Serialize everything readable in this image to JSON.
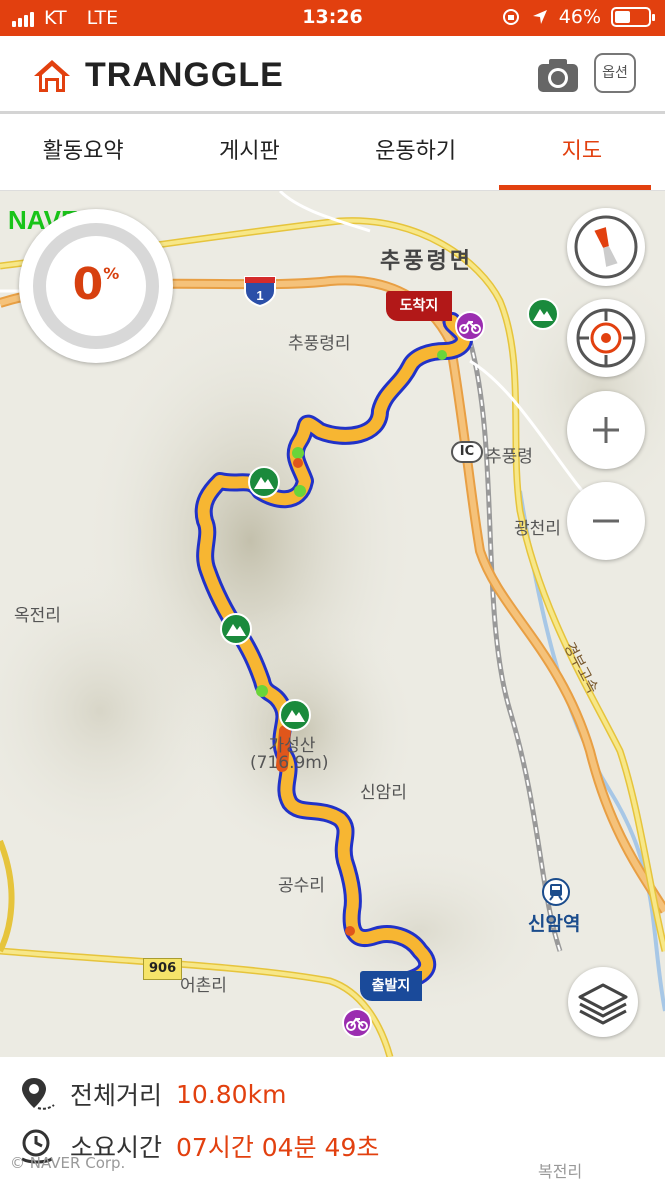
{
  "status_bar": {
    "carrier": "KT",
    "network": "LTE",
    "time": "13:26",
    "battery": "46%",
    "battery_level": 0.46
  },
  "header": {
    "app_name": "TRANGGLE",
    "option_label": "옵션"
  },
  "tabs": [
    {
      "label": "활동요약",
      "active": false
    },
    {
      "label": "게시판",
      "active": false
    },
    {
      "label": "운동하기",
      "active": false
    },
    {
      "label": "지도",
      "active": true
    }
  ],
  "map": {
    "provider_logo": "NAVER",
    "progress": {
      "value": "0",
      "unit": "%"
    },
    "labels": {
      "town": "추풍령면",
      "village1": "추풍령리",
      "ic": "추풍령",
      "village2": "광천리",
      "village3": "옥전리",
      "mountain_name": "가성산",
      "mountain_height": "(716.9m)",
      "village4": "신암리",
      "village5": "공수리",
      "village6": "어촌리",
      "station": "신암역",
      "highway": "경부고속",
      "bottom_village": "복전리"
    },
    "route_shields": {
      "national": "1",
      "local": "906"
    },
    "ic_badge": "IC",
    "flags": {
      "end": "도착지",
      "start": "출발지"
    },
    "controls": [
      "compass-icon",
      "gps-target-icon",
      "zoom-in-icon",
      "zoom-out-icon",
      "layers-icon"
    ],
    "colors": {
      "route": "#f7b632",
      "route_outline": "#2132c8",
      "accent": "#e2400f"
    }
  },
  "summary": {
    "distance_label": "전체거리",
    "distance_value": "10.80km",
    "time_label": "소요시간",
    "time_value": "07시간 04분 49초"
  },
  "footer": {
    "copyright": "© NAVER Corp."
  }
}
